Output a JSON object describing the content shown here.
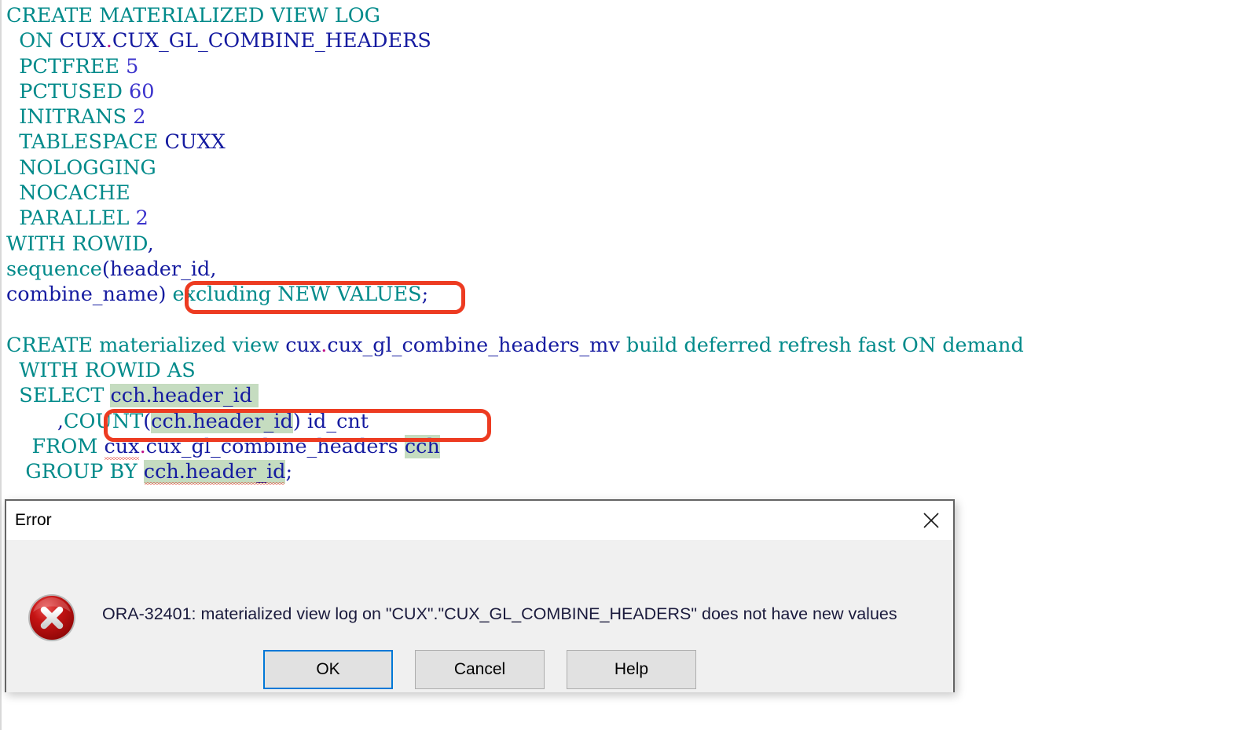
{
  "editor": {
    "code_lines": [
      {
        "id": "line-1",
        "tokens": [
          {
            "t": "CREATE MATERIALIZED VIEW LOG",
            "c": "kw"
          }
        ]
      },
      {
        "id": "line-2",
        "tokens": [
          {
            "t": "  ",
            "c": "plain"
          },
          {
            "t": "ON",
            "c": "kw"
          },
          {
            "t": " ",
            "c": "plain"
          },
          {
            "t": "CUX",
            "c": "id"
          },
          {
            "t": ".",
            "c": "pun"
          },
          {
            "t": "CUX_GL_COMBINE_HEADERS",
            "c": "id"
          }
        ]
      },
      {
        "id": "line-3",
        "tokens": [
          {
            "t": "  ",
            "c": "plain"
          },
          {
            "t": "PCTFREE",
            "c": "kw"
          },
          {
            "t": " ",
            "c": "plain"
          },
          {
            "t": "5",
            "c": "num"
          }
        ]
      },
      {
        "id": "line-4",
        "tokens": [
          {
            "t": "  ",
            "c": "plain"
          },
          {
            "t": "PCTUSED",
            "c": "kw"
          },
          {
            "t": " ",
            "c": "plain"
          },
          {
            "t": "60",
            "c": "num"
          }
        ]
      },
      {
        "id": "line-5",
        "tokens": [
          {
            "t": "  ",
            "c": "plain"
          },
          {
            "t": "INITRANS",
            "c": "kw"
          },
          {
            "t": " ",
            "c": "plain"
          },
          {
            "t": "2",
            "c": "num"
          }
        ]
      },
      {
        "id": "line-6",
        "tokens": [
          {
            "t": "  ",
            "c": "plain"
          },
          {
            "t": "TABLESPACE",
            "c": "kw"
          },
          {
            "t": " ",
            "c": "plain"
          },
          {
            "t": "CUXX",
            "c": "id"
          }
        ]
      },
      {
        "id": "line-7",
        "tokens": [
          {
            "t": "  ",
            "c": "plain"
          },
          {
            "t": "NOLOGGING",
            "c": "kw"
          }
        ]
      },
      {
        "id": "line-8",
        "tokens": [
          {
            "t": "  ",
            "c": "plain"
          },
          {
            "t": "NOCACHE",
            "c": "kw"
          }
        ]
      },
      {
        "id": "line-9",
        "tokens": [
          {
            "t": "  ",
            "c": "plain"
          },
          {
            "t": "PARALLEL",
            "c": "kw"
          },
          {
            "t": " ",
            "c": "plain"
          },
          {
            "t": "2",
            "c": "num"
          }
        ]
      },
      {
        "id": "line-10",
        "tokens": [
          {
            "t": "WITH ROWID",
            "c": "kw"
          },
          {
            "t": ",",
            "c": "pun2"
          }
        ]
      },
      {
        "id": "line-11",
        "tokens": [
          {
            "t": "sequence",
            "c": "kw"
          },
          {
            "t": "(",
            "c": "pun2"
          },
          {
            "t": "header_id",
            "c": "id"
          },
          {
            "t": ",",
            "c": "pun2"
          }
        ]
      },
      {
        "id": "line-12",
        "tokens": [
          {
            "t": "combine_name",
            "c": "id"
          },
          {
            "t": ") ",
            "c": "pun2"
          },
          {
            "t": "excluding NEW VALUES",
            "c": "kw"
          },
          {
            "t": ";",
            "c": "pun2"
          }
        ]
      },
      {
        "id": "line-13",
        "tokens": []
      },
      {
        "id": "line-14",
        "tokens": [
          {
            "t": "CREATE materialized view ",
            "c": "kw"
          },
          {
            "t": "cux",
            "c": "id"
          },
          {
            "t": ".",
            "c": "pun"
          },
          {
            "t": "cux_gl_combine_headers_mv",
            "c": "id"
          },
          {
            "t": " build deferred refresh fast ON demand",
            "c": "kw"
          }
        ]
      },
      {
        "id": "line-15",
        "tokens": [
          {
            "t": "  ",
            "c": "plain"
          },
          {
            "t": "WITH ROWID AS",
            "c": "kw"
          }
        ]
      },
      {
        "id": "line-16",
        "tokens": [
          {
            "t": "  ",
            "c": "plain"
          },
          {
            "t": "SELECT",
            "c": "kw"
          },
          {
            "t": " ",
            "c": "plain"
          },
          {
            "t": "cch.header_id",
            "c": "id hl"
          },
          {
            "t": " ",
            "c": "hl"
          }
        ]
      },
      {
        "id": "line-17",
        "tokens": [
          {
            "t": "        ",
            "c": "plain"
          },
          {
            "t": ",",
            "c": "pun2"
          },
          {
            "t": "COUNT",
            "c": "kw"
          },
          {
            "t": "(",
            "c": "pun2"
          },
          {
            "t": "cch.header_id",
            "c": "id hl"
          },
          {
            "t": ")",
            "c": "pun2"
          },
          {
            "t": " ",
            "c": "plain"
          },
          {
            "t": "id_cnt",
            "c": "id"
          }
        ]
      },
      {
        "id": "line-18",
        "tokens": [
          {
            "t": "    ",
            "c": "plain"
          },
          {
            "t": "FROM",
            "c": "kw"
          },
          {
            "t": " ",
            "c": "plain"
          },
          {
            "t": "cux",
            "c": "id squig"
          },
          {
            "t": ".",
            "c": "pun"
          },
          {
            "t": "cux_gl_combine_headers",
            "c": "id"
          },
          {
            "t": " ",
            "c": "plain"
          },
          {
            "t": "cch",
            "c": "id hl"
          }
        ]
      },
      {
        "id": "line-19",
        "tokens": [
          {
            "t": "   ",
            "c": "plain"
          },
          {
            "t": "GROUP BY",
            "c": "kw"
          },
          {
            "t": " ",
            "c": "plain"
          },
          {
            "t": "cch.header_id",
            "c": "id hl squig"
          },
          {
            "t": ";",
            "c": "pun2"
          }
        ]
      }
    ],
    "annotations": [
      {
        "id": "annot-excluding",
        "label": "excluding NEW VALUES;",
        "color": "#ED3B21"
      },
      {
        "id": "annot-count",
        "label": ",COUNT(cch.header_id) id_cnt",
        "color": "#ED3B21"
      }
    ],
    "highlight_color": "#C5DCC0",
    "keyword_color": "#008A8A",
    "identifier_color": "#151BA0",
    "number_color": "#3B33CC"
  },
  "dialog": {
    "title": "Error",
    "close_label": "Close",
    "icon": "error-circle-x-icon",
    "message": "ORA-32401: materialized view log on \"CUX\".\"CUX_GL_COMBINE_HEADERS\" does not have new values",
    "buttons": [
      {
        "id": "ok",
        "label": "OK",
        "focused": true
      },
      {
        "id": "cancel",
        "label": "Cancel",
        "focused": false
      },
      {
        "id": "help",
        "label": "Help",
        "focused": false
      }
    ],
    "background": "#F0F0F0",
    "titlebar_background": "#FFFFFF",
    "border_color": "#646464",
    "focus_color": "#0078D7",
    "error_icon_color": "#C00000"
  }
}
